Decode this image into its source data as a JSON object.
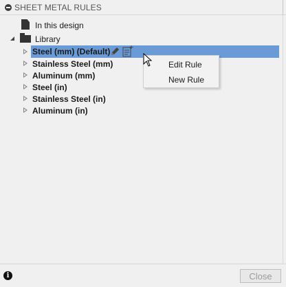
{
  "header": {
    "title": "SHEET METAL RULES"
  },
  "tree": {
    "in_this_design": "In this design",
    "library": "Library",
    "rules": [
      {
        "label": "Steel (mm) (Default)",
        "selected": true
      },
      {
        "label": "Stainless Steel (mm)",
        "selected": false
      },
      {
        "label": "Aluminum (mm)",
        "selected": false
      },
      {
        "label": "Steel (in)",
        "selected": false
      },
      {
        "label": "Stainless Steel (in)",
        "selected": false
      },
      {
        "label": "Aluminum (in)",
        "selected": false
      }
    ]
  },
  "context_menu": {
    "items": [
      "Edit Rule",
      "New Rule"
    ]
  },
  "footer": {
    "close_label": "Close",
    "info_glyph": "i"
  },
  "colors": {
    "selection": "#6b9bd6",
    "background": "#f0f0f0"
  },
  "icons": [
    "collapse-icon",
    "document-icon",
    "folder-icon",
    "pencil-icon",
    "rule-icon",
    "info-icon",
    "cursor-icon"
  ]
}
